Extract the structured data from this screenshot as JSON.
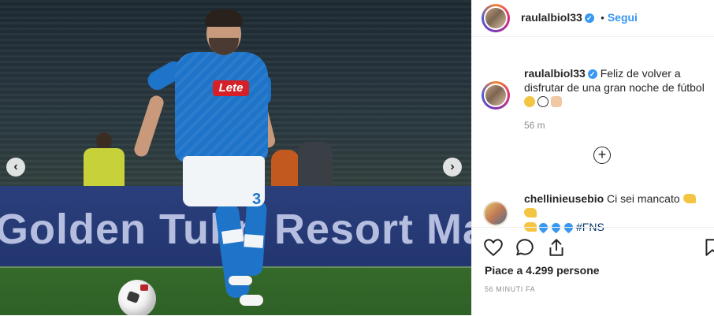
{
  "post": {
    "username": "raulalbiol33",
    "follow_dot": "•",
    "follow_label": "Segui",
    "caption_user": "raulalbiol33",
    "caption_text": "Feliz de volver a disfrutar de una gran noche de fútbol",
    "caption_emojis": [
      "smile",
      "soccer-ball",
      "clap"
    ],
    "time": "56 m",
    "load_more_symbol": "+"
  },
  "media": {
    "board_text": "Golden Tulip Resort Mar",
    "sponsor": "Lete",
    "shirt_number": "3",
    "prev_symbol": "‹",
    "next_symbol": "›"
  },
  "comment": {
    "username": "chellinieusebio",
    "text": "Ci sei mancato",
    "hashtag": "#FNS",
    "emojis": [
      "flexed-biceps",
      "flexed-biceps",
      "flexed-biceps",
      "blue-heart",
      "blue-heart",
      "blue-heart"
    ]
  },
  "footer": {
    "likes_prefix": "Piace a",
    "likes_count": "4.299",
    "likes_suffix": "persone",
    "time_ago": "56 MINUTI FA"
  },
  "colors": {
    "accent": "#3897f0",
    "text": "#262626",
    "muted": "#8e8e8e",
    "napoli_blue": "#1e74c9"
  }
}
